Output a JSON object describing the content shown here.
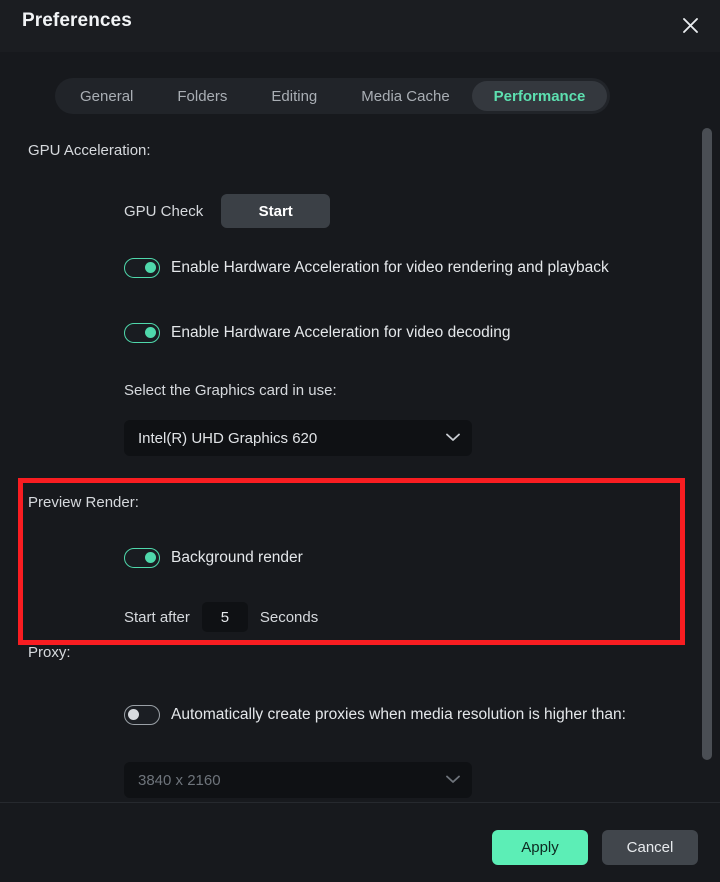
{
  "window": {
    "title": "Preferences",
    "close_icon": "close-icon"
  },
  "tabs": [
    {
      "label": "General",
      "active": false
    },
    {
      "label": "Folders",
      "active": false
    },
    {
      "label": "Editing",
      "active": false
    },
    {
      "label": "Media Cache",
      "active": false
    },
    {
      "label": "Performance",
      "active": true
    }
  ],
  "gpu_section": {
    "heading": "GPU Acceleration:",
    "gpu_check_label": "GPU Check",
    "start_button": "Start",
    "toggle_rendering": {
      "label": "Enable Hardware Acceleration for video rendering and playback",
      "state": "on"
    },
    "toggle_decoding": {
      "label": "Enable Hardware Acceleration for video decoding",
      "state": "on"
    },
    "graphics_card_label": "Select the Graphics card in use:",
    "graphics_card_value": "Intel(R) UHD Graphics 620"
  },
  "preview_render_section": {
    "heading": "Preview Render:",
    "toggle_background_render": {
      "label": "Background render",
      "state": "on"
    },
    "start_after_label": "Start after",
    "start_after_value": "5",
    "seconds_label": "Seconds",
    "highlighted": true,
    "highlight_color": "#f81d21"
  },
  "proxy_section": {
    "heading": "Proxy:",
    "toggle_auto_proxy": {
      "label": "Automatically create proxies when media resolution is higher than:",
      "state": "off"
    },
    "resolution_value": "3840 x 2160",
    "resolution_disabled": true
  },
  "footer": {
    "apply_label": "Apply",
    "cancel_label": "Cancel"
  },
  "colors": {
    "accent": "#5ceeb6",
    "toggle_on": "#4fd8ab",
    "tab_active_text": "#5de0b0",
    "background": "#17191d",
    "highlight": "#f81d21"
  }
}
